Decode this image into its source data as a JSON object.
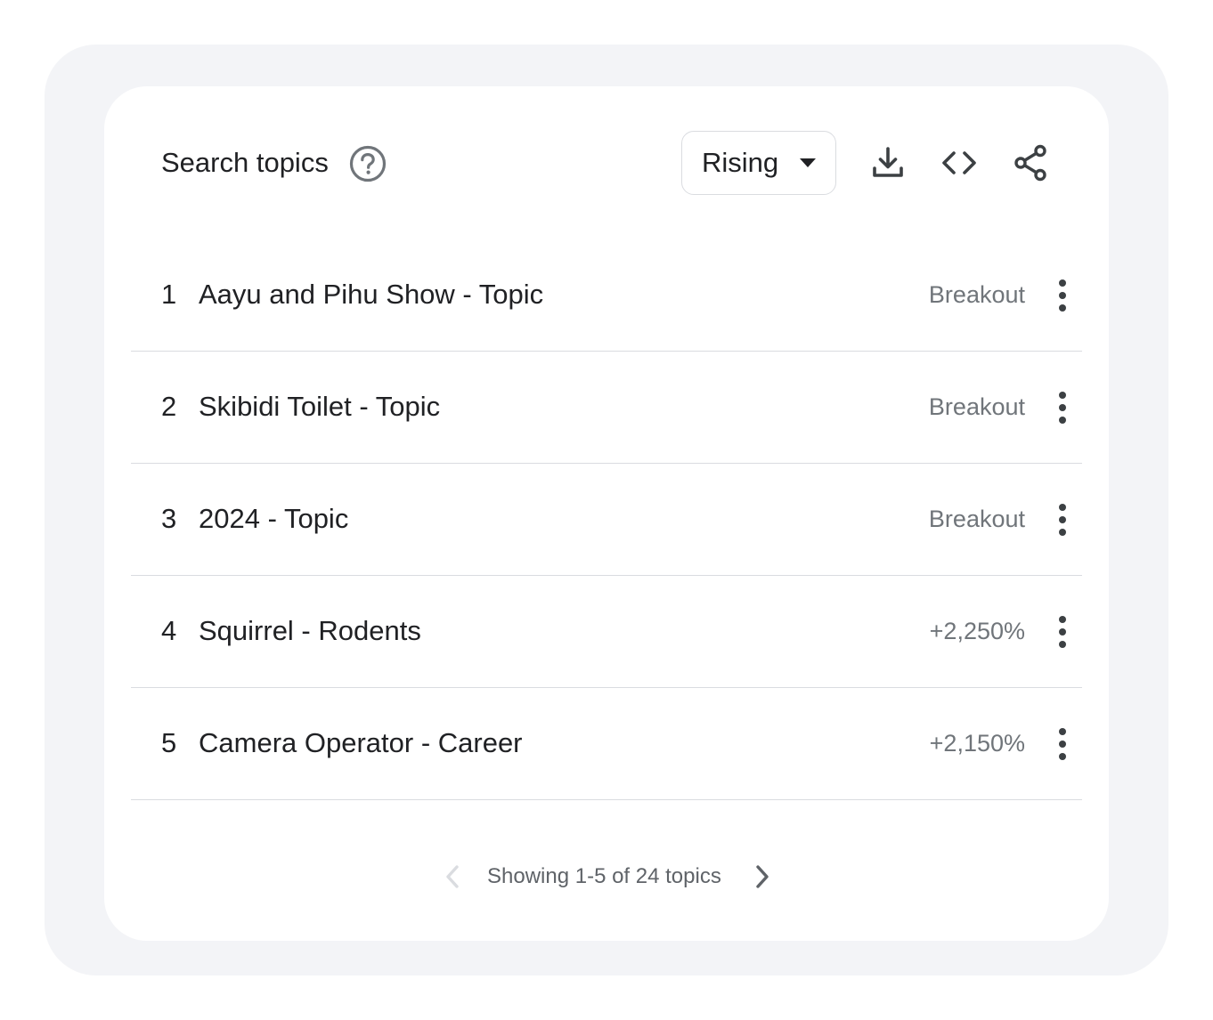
{
  "widget": {
    "title": "Search topics",
    "help_icon": "help-circle-icon"
  },
  "dropdown": {
    "selected": "Rising"
  },
  "toolbar": {
    "download_icon": "download-icon",
    "embed_icon": "code-icon",
    "share_icon": "share-icon"
  },
  "rows": [
    {
      "rank": "1",
      "label": "Aayu and Pihu Show - Topic",
      "value": "Breakout"
    },
    {
      "rank": "2",
      "label": "Skibidi Toilet - Topic",
      "value": "Breakout"
    },
    {
      "rank": "3",
      "label": "2024 - Topic",
      "value": "Breakout"
    },
    {
      "rank": "4",
      "label": "Squirrel - Rodents",
      "value": "+2,250%"
    },
    {
      "rank": "5",
      "label": "Camera Operator - Career",
      "value": "+2,150%"
    }
  ],
  "pager": {
    "text": "Showing 1-5 of 24 topics"
  },
  "colors": {
    "outer_bg": "#f3f4f7",
    "card_bg": "#ffffff",
    "text_primary": "#202124",
    "text_secondary": "#70757a",
    "divider": "#dadce0",
    "icon": "#5f6368"
  }
}
